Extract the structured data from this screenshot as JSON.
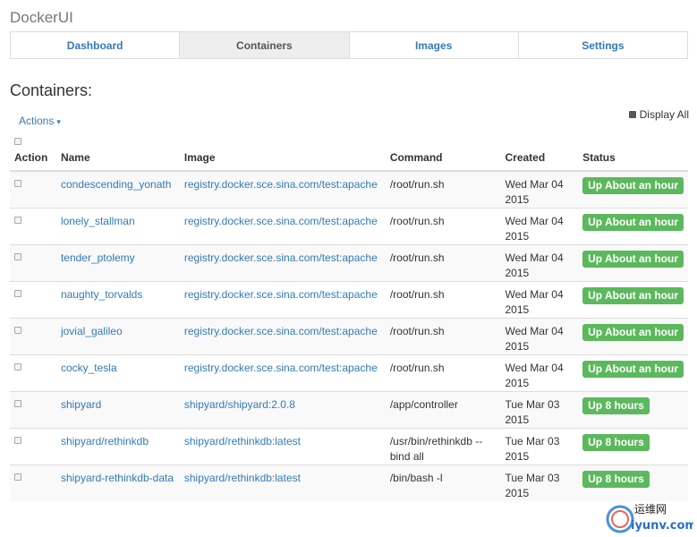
{
  "app": {
    "brand": "DockerUI"
  },
  "nav": {
    "tabs": [
      {
        "label": "Dashboard",
        "active": false
      },
      {
        "label": "Containers",
        "active": true
      },
      {
        "label": "Images",
        "active": false
      },
      {
        "label": "Settings",
        "active": false
      }
    ]
  },
  "page": {
    "title": "Containers:",
    "actions_label": "Actions",
    "display_all_label": "Display All",
    "display_all_checked": true
  },
  "table": {
    "headers": {
      "action": "Action",
      "name": "Name",
      "image": "Image",
      "command": "Command",
      "created": "Created",
      "status": "Status"
    },
    "rows": [
      {
        "name": "condescending_yonath",
        "image": "registry.docker.sce.sina.com/test:apache",
        "command": "/root/run.sh",
        "created": "Wed Mar 04 2015",
        "status": "Up About an hour"
      },
      {
        "name": "lonely_stallman",
        "image": "registry.docker.sce.sina.com/test:apache",
        "command": "/root/run.sh",
        "created": "Wed Mar 04 2015",
        "status": "Up About an hour"
      },
      {
        "name": "tender_ptolemy",
        "image": "registry.docker.sce.sina.com/test:apache",
        "command": "/root/run.sh",
        "created": "Wed Mar 04 2015",
        "status": "Up About an hour"
      },
      {
        "name": "naughty_torvalds",
        "image": "registry.docker.sce.sina.com/test:apache",
        "command": "/root/run.sh",
        "created": "Wed Mar 04 2015",
        "status": "Up About an hour"
      },
      {
        "name": "jovial_galileo",
        "image": "registry.docker.sce.sina.com/test:apache",
        "command": "/root/run.sh",
        "created": "Wed Mar 04 2015",
        "status": "Up About an hour"
      },
      {
        "name": "cocky_tesla",
        "image": "registry.docker.sce.sina.com/test:apache",
        "command": "/root/run.sh",
        "created": "Wed Mar 04 2015",
        "status": "Up About an hour"
      },
      {
        "name": "shipyard",
        "image": "shipyard/shipyard:2.0.8",
        "command": "/app/controller",
        "created": "Tue Mar 03 2015",
        "status": "Up 8 hours"
      },
      {
        "name": "shipyard/rethinkdb",
        "image": "shipyard/rethinkdb:latest",
        "command": "/usr/bin/rethinkdb --bind all",
        "created": "Tue Mar 03 2015",
        "status": "Up 8 hours"
      },
      {
        "name": "shipyard-rethinkdb-data",
        "image": "shipyard/rethinkdb:latest",
        "command": "/bin/bash -l",
        "created": "Tue Mar 03 2015",
        "status": "Up 8 hours"
      }
    ]
  },
  "watermark": {
    "text_cn": "运维网",
    "text_url": "iyunv.com"
  }
}
